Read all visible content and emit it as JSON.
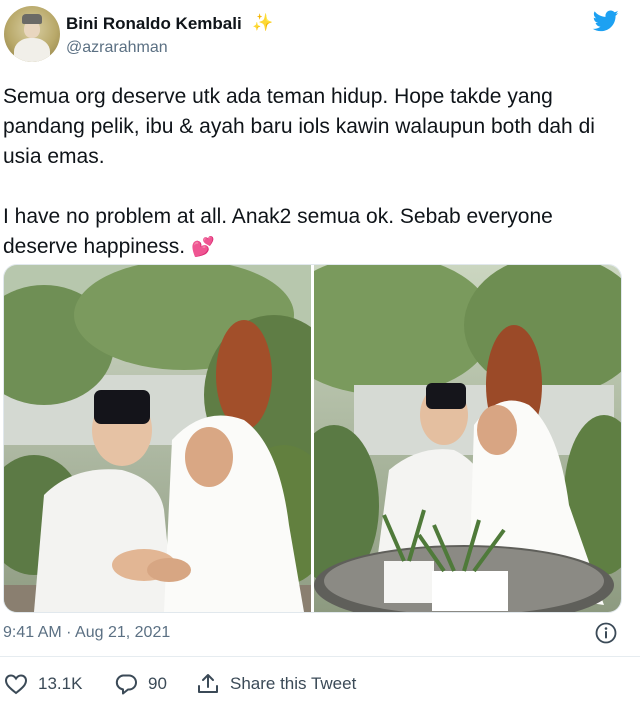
{
  "user": {
    "display_name": "Bini Ronaldo Kembali",
    "name_emoji": "✨",
    "handle": "@azrarahman",
    "avatar_icon": "profile-avatar"
  },
  "brand": {
    "icon": "twitter-bird-icon",
    "color": "#1da1f2"
  },
  "tweet": {
    "paragraph1": "Semua org deserve utk ada teman hidup. Hope takde yang pandang pelik, ibu & ayah baru iols kawin walaupun both dah di usia emas.",
    "paragraph2": "I have no problem at all. Anak2 semua ok. Sebab everyone deserve happiness.",
    "heart_emoji": "💕"
  },
  "meta": {
    "timestamp": "9:41 AM · Aug 21, 2021"
  },
  "actions": {
    "likes": "13.1K",
    "replies": "90",
    "share_label": "Share this Tweet"
  },
  "colors": {
    "like": "#e0245e",
    "text": "#0f1419",
    "muted": "#5b7083"
  }
}
